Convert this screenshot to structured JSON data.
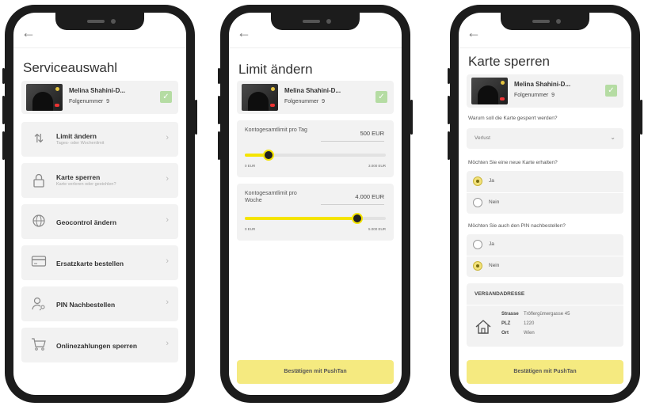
{
  "screens": {
    "service": {
      "title": "Serviceauswahl",
      "card": {
        "name": "Melina Shahini-D...",
        "number_label": "Folgenummer",
        "number": "9"
      },
      "items": [
        {
          "label": "Limit ändern",
          "sub": "Tages- oder Wochenlimit",
          "icon": "sort-arrows-icon"
        },
        {
          "label": "Karte sperren",
          "sub": "Karte verloren oder gestohlen?",
          "icon": "lock-icon"
        },
        {
          "label": "Geocontrol ändern",
          "sub": "",
          "icon": "globe-icon"
        },
        {
          "label": "Ersatzkarte bestellen",
          "sub": "",
          "icon": "credit-card-icon"
        },
        {
          "label": "PIN Nachbestellen",
          "sub": "",
          "icon": "user-key-icon"
        },
        {
          "label": "Onlinezahlungen sperren",
          "sub": "",
          "icon": "shopping-cart-icon"
        }
      ]
    },
    "limit": {
      "title": "Limit ändern",
      "card": {
        "name": "Melina Shahini-D...",
        "number_label": "Folgenummer",
        "number": "9"
      },
      "limits": [
        {
          "label": "Kontogesamtlimit pro Tag",
          "value": "500 EUR",
          "min": "0 EUR",
          "max": "3.000 EUR",
          "fraction": 0.17
        },
        {
          "label": "Kontogesamtlimit pro Woche",
          "value": "4.000 EUR",
          "min": "0 EUR",
          "max": "5.000 EUR",
          "fraction": 0.8
        }
      ],
      "confirm": "Bestätigen mit PushTan"
    },
    "block": {
      "title": "Karte sperren",
      "card": {
        "name": "Melina Shahini-D...",
        "number_label": "Folgenummer",
        "number": "9"
      },
      "q_reason": "Warum soll die Karte gesperrt werden?",
      "reason_value": "Verlust",
      "q_newcard": "Möchten Sie eine neue Karte erhalten?",
      "newcard_options": [
        "Ja",
        "Nein"
      ],
      "newcard_selected": "Ja",
      "q_pin": "Möchten Sie auch den PIN nachbestellen?",
      "pin_options": [
        "Ja",
        "Nein"
      ],
      "pin_selected": "Nein",
      "address": {
        "heading": "VERSANDADRESSE",
        "rows": [
          {
            "key": "Strasse",
            "value": "Trôflergümergasse 45"
          },
          {
            "key": "PLZ",
            "value": "1220"
          },
          {
            "key": "Ort",
            "value": "Wien"
          }
        ]
      },
      "confirm": "Bestätigen mit PushTan"
    }
  },
  "colors": {
    "accent": "#f5e400",
    "button": "#f5ea80",
    "check": "#b5dca3",
    "panel": "#f2f2f2"
  }
}
